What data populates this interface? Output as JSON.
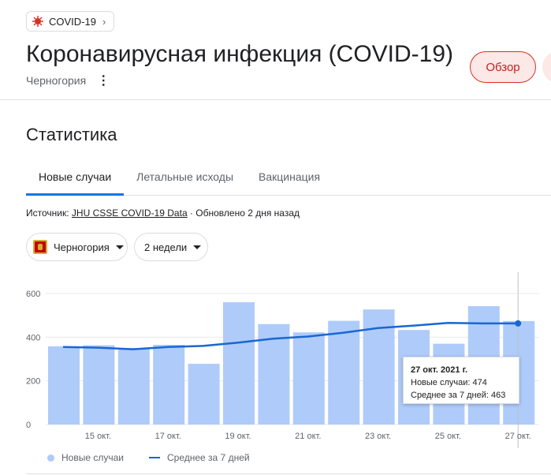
{
  "chip": {
    "label": "COVID-19",
    "icon": "virus-icon",
    "chevron": "›"
  },
  "header": {
    "title": "Коронавирусная инфекция (COVID-19)",
    "subtitle": "Черногория",
    "overview_button": "Обзор"
  },
  "stats": {
    "title": "Статистика",
    "tabs": [
      {
        "label": "Новые случаи",
        "active": true
      },
      {
        "label": "Летальные исходы",
        "active": false
      },
      {
        "label": "Вакцинация",
        "active": false
      }
    ],
    "source_prefix": "Источник: ",
    "source_link": "JHU CSSE COVID-19 Data",
    "source_suffix": " · Обновлено 2 дня назад",
    "region_dropdown": "Черногория",
    "period_dropdown": "2 недели"
  },
  "colors": {
    "bar": "#aecbfa",
    "line": "#1967d2",
    "accent_red": "#d93025",
    "tab_underline": "#1a73e8"
  },
  "chart_data": {
    "type": "bar",
    "series": [
      {
        "name": "Новые случаи",
        "type": "bar",
        "values": [
          358,
          363,
          350,
          365,
          278,
          560,
          460,
          422,
          475,
          527,
          433,
          370,
          542,
          474
        ]
      },
      {
        "name": "Среднее за 7 дней",
        "type": "line",
        "values": [
          355,
          352,
          345,
          355,
          360,
          375,
          393,
          403,
          420,
          442,
          453,
          465,
          463,
          463
        ]
      }
    ],
    "x_tick_labels": [
      "15 окт.",
      "17 окт.",
      "19 окт.",
      "21 окт.",
      "23 окт.",
      "25 окт.",
      "27 окт."
    ],
    "y_ticks": [
      0,
      200,
      400,
      600
    ],
    "ylim": [
      0,
      660
    ],
    "grid": true,
    "legend": "bottom-left",
    "tooltip": {
      "title": "27 окт. 2021 г.",
      "line1": "Новые случаи: 474",
      "line2": "Среднее за 7 дней: 463"
    }
  }
}
